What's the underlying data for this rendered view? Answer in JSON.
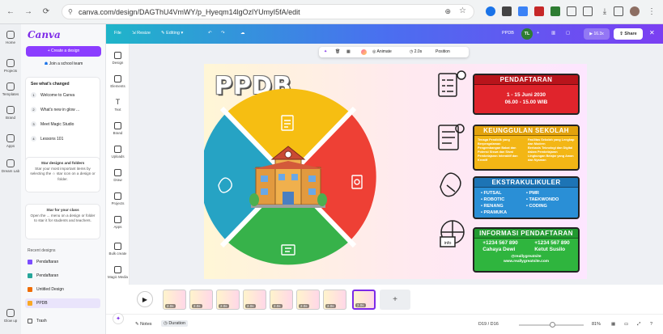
{
  "browser": {
    "url": "canva.com/design/DAGThU4VmWY/p_Hyeqm14lgOzlYUmyI5fA/edit"
  },
  "rail": {
    "items": [
      "Home",
      "Projects",
      "Templates",
      "Brand",
      "Apps",
      "Dream Lab",
      "Glow up"
    ]
  },
  "sidebar": {
    "logo": "Canva",
    "create_label": "+ Create a design",
    "school_label": "Join a school team",
    "whats_changed": {
      "title": "See what's changed",
      "items": [
        "Welcome to Canva",
        "What's new in glow ...",
        "Meet Magic Studio",
        "Lessons 101"
      ]
    },
    "star_card": {
      "title": "Star designs and folders",
      "body": "Star your most important items by selecting the ☆ star icon on a design or folder."
    },
    "star_card2": {
      "title": "Star for your class",
      "body": "Open the ... menu on a design or folder to star it for students and teachers."
    },
    "recent_label": "Recent designs",
    "recent": [
      "Pendaftaran",
      "Pendaftaran",
      "Untitled Design",
      "PPDB"
    ],
    "trash": "Trash"
  },
  "topbar": {
    "file": "File",
    "resize": "Resize",
    "editing": "Editing",
    "doc_title": "PPDB",
    "avatar": "TL",
    "price": "16.3x",
    "share": "Share"
  },
  "tools": [
    "Design",
    "Elements",
    "Text",
    "Brand",
    "Uploads",
    "Draw",
    "Projects",
    "Apps",
    "Bulk create",
    "Magic Media",
    "Media Con..."
  ],
  "context": {
    "animate": "Animate",
    "duration": "2.0s",
    "position": "Position"
  },
  "design": {
    "title": "PPDB",
    "pendaftaran": {
      "title": "PENDAFTARAN",
      "dates": "1 - 15 Juni 2030",
      "time": "06.00 - 15.00 WIB"
    },
    "keunggulan": {
      "title": "KEUNGGULAN SEKOLAH",
      "left": [
        "Tenaga Pendidik yang Berpengalaman",
        "Pengembangan Bakat dan Potensi Siswa dan Siswi",
        "Pembelajaran Interaktif dan Kreatif"
      ],
      "right": [
        "Fasilitas Sekolah yang Lengkap dan Modern",
        "Berbasis Teknologi dan Digital dalam Pembelajaran",
        "Lingkungan Belajar yang Aman dan Nyaman"
      ]
    },
    "ekstra": {
      "title": "EKSTRAKULIKULER",
      "left": [
        "FUTSAL",
        "ROBOTIC",
        "RENANG",
        "PRAMUKA"
      ],
      "right": [
        "PMR",
        "TAEKWONDO",
        "CODING"
      ]
    },
    "informasi": {
      "title": "INFORMASI PENDAFTARAN",
      "phone1": "+1234 567 890",
      "name1": "Cahaya Dewi",
      "phone2": "+1234 567 890",
      "name2": "Ketut Susilo",
      "handle": "@reallygreatsite",
      "site": "www.reallygreatsite.com"
    },
    "info_label": "info"
  },
  "timeline": {
    "pages": [
      "2.0s",
      "2.0s",
      "2.0s",
      "2.0s",
      "2.0s",
      "2.0s",
      "2.0s",
      "2.0s"
    ]
  },
  "footer": {
    "notes": "Notes",
    "duration": "Duration",
    "pages": "D19 / D16",
    "zoom": "81%"
  }
}
